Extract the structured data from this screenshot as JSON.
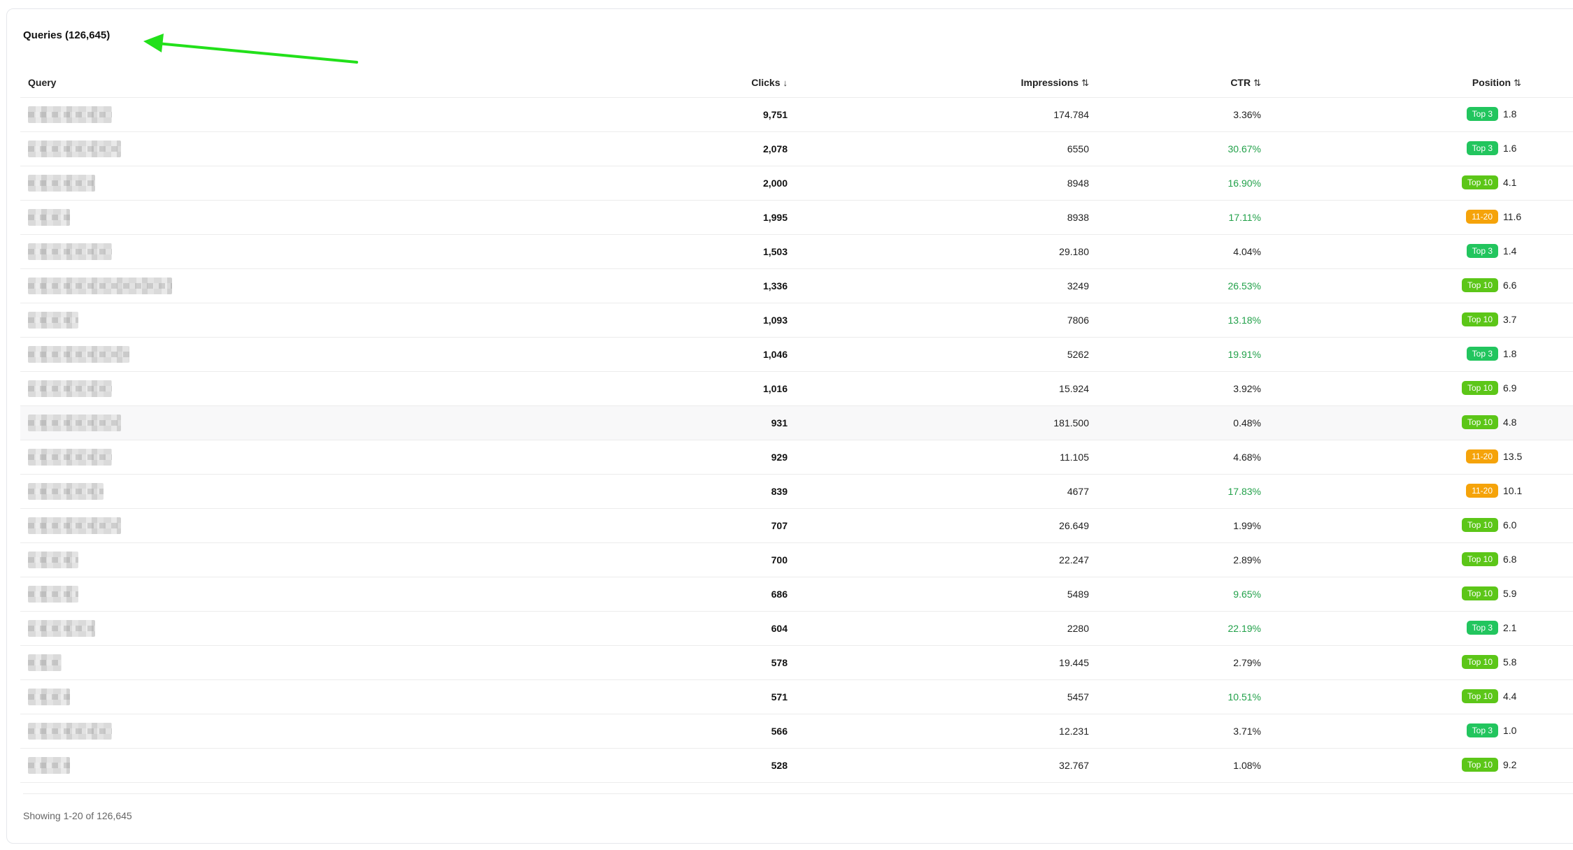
{
  "title": "Queries (126,645)",
  "columns": {
    "query": "Query",
    "clicks": "Clicks",
    "clicks_sort": "↓",
    "impressions": "Impressions",
    "impressions_sort": "⇅",
    "ctr": "CTR",
    "ctr_sort": "⇅",
    "position": "Position",
    "position_sort": "⇅"
  },
  "colors": {
    "top3": "#22c55e",
    "top10": "#5cc618",
    "range_11_20": "#f5a30a",
    "ctr_good": "#22a14a",
    "arrow": "#22e01a"
  },
  "rows": [
    {
      "clicks": "9,751",
      "impressions": "174.784",
      "ctr": "3.36%",
      "ctr_good": false,
      "badge": "Top 3",
      "badge_type": "top3",
      "position": "1.8"
    },
    {
      "clicks": "2,078",
      "impressions": "6550",
      "ctr": "30.67%",
      "ctr_good": true,
      "badge": "Top 3",
      "badge_type": "top3",
      "position": "1.6"
    },
    {
      "clicks": "2,000",
      "impressions": "8948",
      "ctr": "16.90%",
      "ctr_good": true,
      "badge": "Top 10",
      "badge_type": "top10",
      "position": "4.1"
    },
    {
      "clicks": "1,995",
      "impressions": "8938",
      "ctr": "17.11%",
      "ctr_good": true,
      "badge": "11-20",
      "badge_type": "r1120",
      "position": "11.6"
    },
    {
      "clicks": "1,503",
      "impressions": "29.180",
      "ctr": "4.04%",
      "ctr_good": false,
      "badge": "Top 3",
      "badge_type": "top3",
      "position": "1.4"
    },
    {
      "clicks": "1,336",
      "impressions": "3249",
      "ctr": "26.53%",
      "ctr_good": true,
      "badge": "Top 10",
      "badge_type": "top10",
      "position": "6.6"
    },
    {
      "clicks": "1,093",
      "impressions": "7806",
      "ctr": "13.18%",
      "ctr_good": true,
      "badge": "Top 10",
      "badge_type": "top10",
      "position": "3.7"
    },
    {
      "clicks": "1,046",
      "impressions": "5262",
      "ctr": "19.91%",
      "ctr_good": true,
      "badge": "Top 3",
      "badge_type": "top3",
      "position": "1.8"
    },
    {
      "clicks": "1,016",
      "impressions": "15.924",
      "ctr": "3.92%",
      "ctr_good": false,
      "badge": "Top 10",
      "badge_type": "top10",
      "position": "6.9"
    },
    {
      "clicks": "931",
      "impressions": "181.500",
      "ctr": "0.48%",
      "ctr_good": false,
      "badge": "Top 10",
      "badge_type": "top10",
      "position": "4.8"
    },
    {
      "clicks": "929",
      "impressions": "11.105",
      "ctr": "4.68%",
      "ctr_good": false,
      "badge": "11-20",
      "badge_type": "r1120",
      "position": "13.5"
    },
    {
      "clicks": "839",
      "impressions": "4677",
      "ctr": "17.83%",
      "ctr_good": true,
      "badge": "11-20",
      "badge_type": "r1120",
      "position": "10.1"
    },
    {
      "clicks": "707",
      "impressions": "26.649",
      "ctr": "1.99%",
      "ctr_good": false,
      "badge": "Top 10",
      "badge_type": "top10",
      "position": "6.0"
    },
    {
      "clicks": "700",
      "impressions": "22.247",
      "ctr": "2.89%",
      "ctr_good": false,
      "badge": "Top 10",
      "badge_type": "top10",
      "position": "6.8"
    },
    {
      "clicks": "686",
      "impressions": "5489",
      "ctr": "9.65%",
      "ctr_good": true,
      "badge": "Top 10",
      "badge_type": "top10",
      "position": "5.9"
    },
    {
      "clicks": "604",
      "impressions": "2280",
      "ctr": "22.19%",
      "ctr_good": true,
      "badge": "Top 3",
      "badge_type": "top3",
      "position": "2.1"
    },
    {
      "clicks": "578",
      "impressions": "19.445",
      "ctr": "2.79%",
      "ctr_good": false,
      "badge": "Top 10",
      "badge_type": "top10",
      "position": "5.8"
    },
    {
      "clicks": "571",
      "impressions": "5457",
      "ctr": "10.51%",
      "ctr_good": true,
      "badge": "Top 10",
      "badge_type": "top10",
      "position": "4.4"
    },
    {
      "clicks": "566",
      "impressions": "12.231",
      "ctr": "3.71%",
      "ctr_good": false,
      "badge": "Top 3",
      "badge_type": "top3",
      "position": "1.0"
    },
    {
      "clicks": "528",
      "impressions": "32.767",
      "ctr": "1.08%",
      "ctr_good": false,
      "badge": "Top 10",
      "badge_type": "top10",
      "position": "9.2"
    }
  ],
  "footer": "Showing 1-20 of 126,645"
}
